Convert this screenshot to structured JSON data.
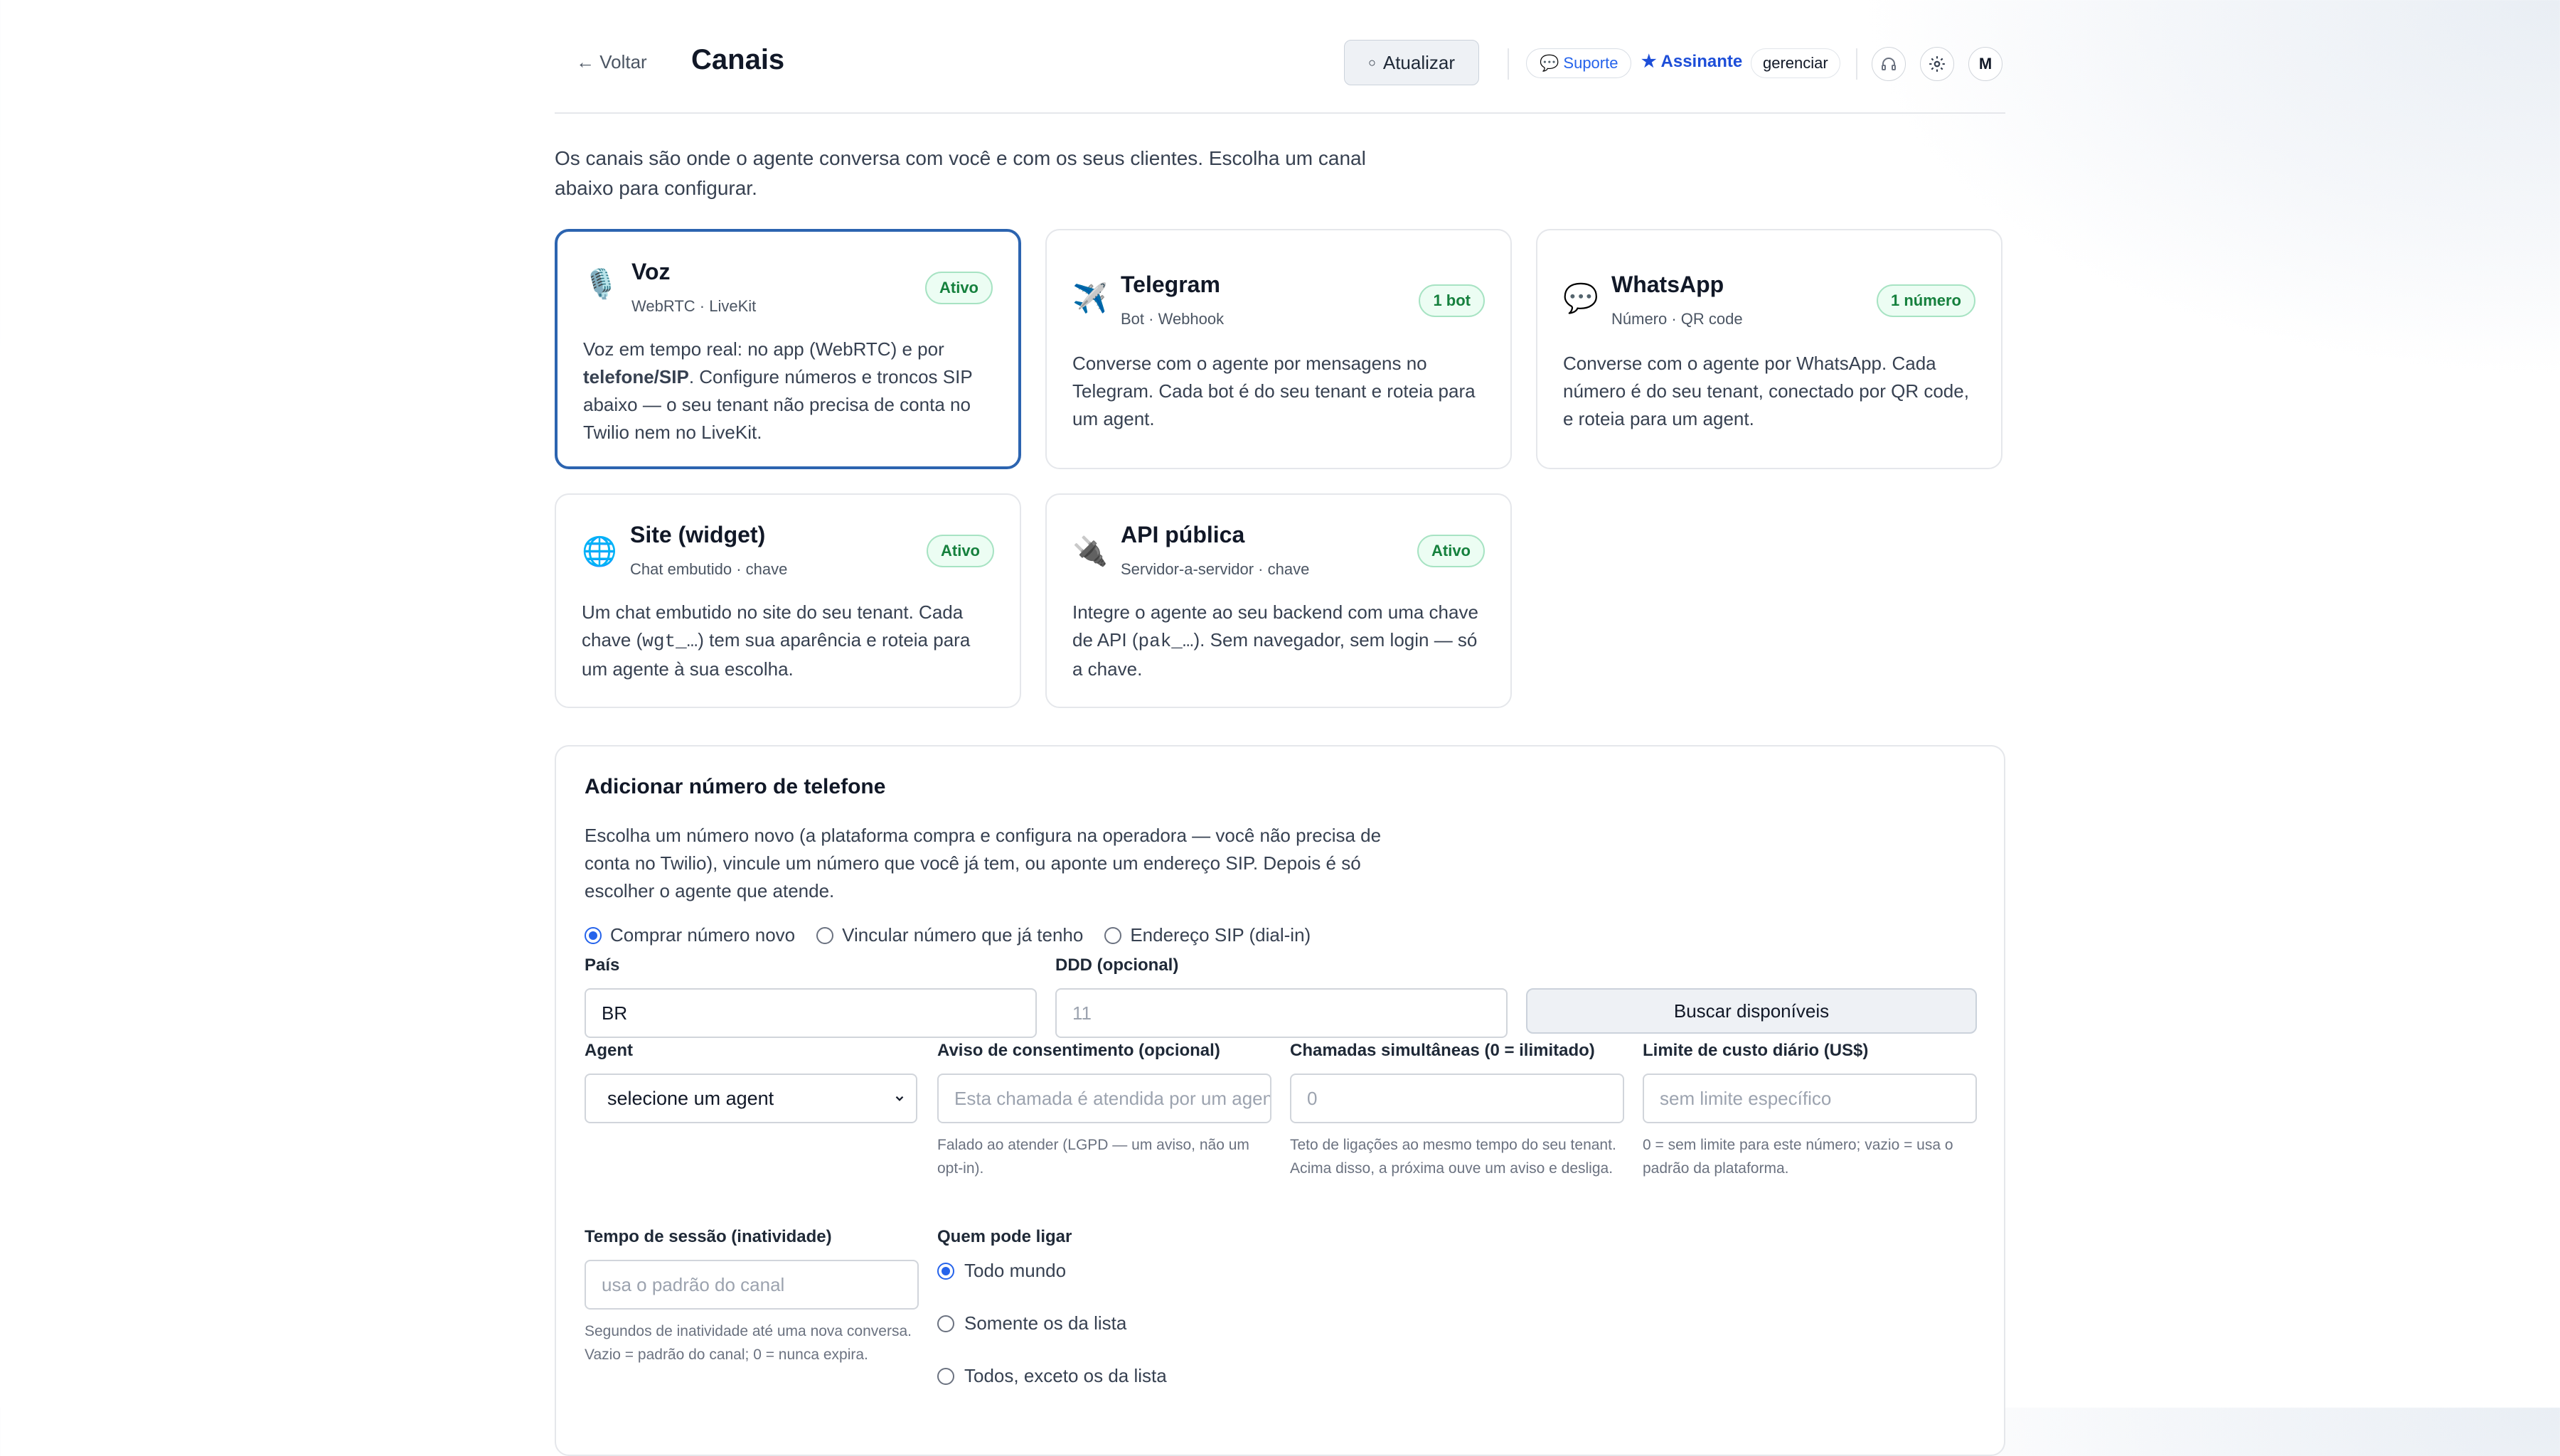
{
  "header": {
    "back_label": "← Voltar",
    "title": "Canais",
    "refresh_label": "Atualizar",
    "support_label": "Suporte",
    "subscriber_label": "Assinante",
    "manage_label": "gerenciar",
    "avatar_initial": "M"
  },
  "intro": "Os canais são onde o agente conversa com você e com os seus clientes. Escolha um canal abaixo para configurar.",
  "channels": [
    {
      "name": "Voz",
      "subtitle": "WebRTC · LiveKit",
      "badge": "Ativo",
      "icon": "microphone-icon"
    },
    {
      "name": "Telegram",
      "subtitle": "Bot · Webhook",
      "badge": "1 bot",
      "icon": "airplane-icon",
      "description": "Converse com o agente por mensagens no Telegram. Cada bot é do seu tenant e roteia para um agent."
    },
    {
      "name": "WhatsApp",
      "subtitle": "Número · QR code",
      "badge": "1 número",
      "icon": "speech-bubble-icon",
      "description": "Converse com o agente por WhatsApp. Cada número é do seu tenant, conectado por QR code, e roteia para um agent."
    },
    {
      "name": "Site (widget)",
      "subtitle": "Chat embutido · chave",
      "badge": "Ativo",
      "icon": "globe-icon",
      "description_pre": "Um chat embutido no site do seu tenant. Cada chave (",
      "description_code": "wgt_…",
      "description_post": ") tem sua aparência e roteia para um agente à sua escolha."
    },
    {
      "name": "API pública",
      "subtitle": "Servidor-a-servidor · chave",
      "badge": "Ativo",
      "icon": "plug-icon",
      "description_pre": "Integre o agente ao seu backend com uma chave de API (",
      "description_code": "pak_…",
      "description_post": "). Sem navegador, sem login — só a chave."
    }
  ],
  "voice_desc": {
    "pre": "Voz em tempo real: no app (WebRTC) e por ",
    "bold": "telefone/SIP",
    "post": ". Configure números e troncos SIP abaixo — o seu tenant não precisa de conta no Twilio nem no LiveKit."
  },
  "add_phone": {
    "title": "Adicionar número de telefone",
    "description": "Escolha um número novo (a plataforma compra e configura na operadora — você não precisa de conta no Twilio), vincule um número que você já tem, ou aponte um endereço SIP. Depois é só escolher o agente que atende.",
    "modes": [
      "Comprar número novo",
      "Vincular número que já tenho",
      "Endereço SIP (dial-in)"
    ],
    "selected_mode": "Comprar número novo",
    "country_label": "País",
    "country_value": "BR",
    "ddd_label": "DDD (opcional)",
    "ddd_placeholder": "11",
    "search_button": "Buscar disponíveis",
    "agent_label": "Agent",
    "agent_value": "selecione um agent",
    "consent_label": "Aviso de consentimento (opcional)",
    "consent_placeholder": "Esta chamada é atendida por um agente",
    "consent_help": "Falado ao atender (LGPD — um aviso, não um opt-in).",
    "concurrent_label": "Chamadas simultâneas (0 = ilimitado)",
    "concurrent_placeholder": "0",
    "concurrent_help": "Teto de ligações ao mesmo tempo do seu tenant. Acima disso, a próxima ouve um aviso e desliga.",
    "cost_label": "Limite de custo diário (US$)",
    "cost_placeholder": "sem limite específico",
    "cost_help": "0 = sem limite para este número; vazio = usa o padrão da plataforma.",
    "session_label": "Tempo de sessão (inatividade)",
    "session_placeholder": "usa o padrão do canal",
    "session_help": "Segundos de inatividade até uma nova conversa. Vazio = padrão do canal; 0 = nunca expira.",
    "who_label": "Quem pode ligar",
    "who_options": [
      "Todo mundo",
      "Somente os da lista",
      "Todos, exceto os da lista"
    ],
    "who_selected": "Todo mundo"
  },
  "colors": {
    "accent": "#2563eb",
    "selected_border": "#2c64b0",
    "badge_green": "#15803d"
  }
}
